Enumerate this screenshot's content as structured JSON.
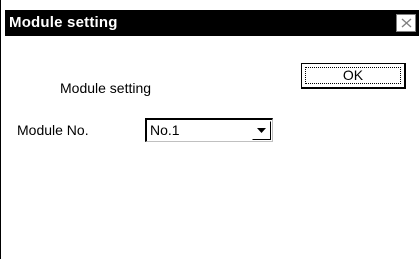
{
  "window": {
    "title": "Module setting",
    "close_glyph": "close-icon"
  },
  "dialog": {
    "heading": "Module setting",
    "module_label": "Module No.",
    "module_select": {
      "value": "No.1"
    },
    "ok_label": "OK"
  },
  "colors": {
    "titlebar": "#000000",
    "title_text": "#ffffff",
    "background": "#ffffff",
    "text": "#000000"
  }
}
